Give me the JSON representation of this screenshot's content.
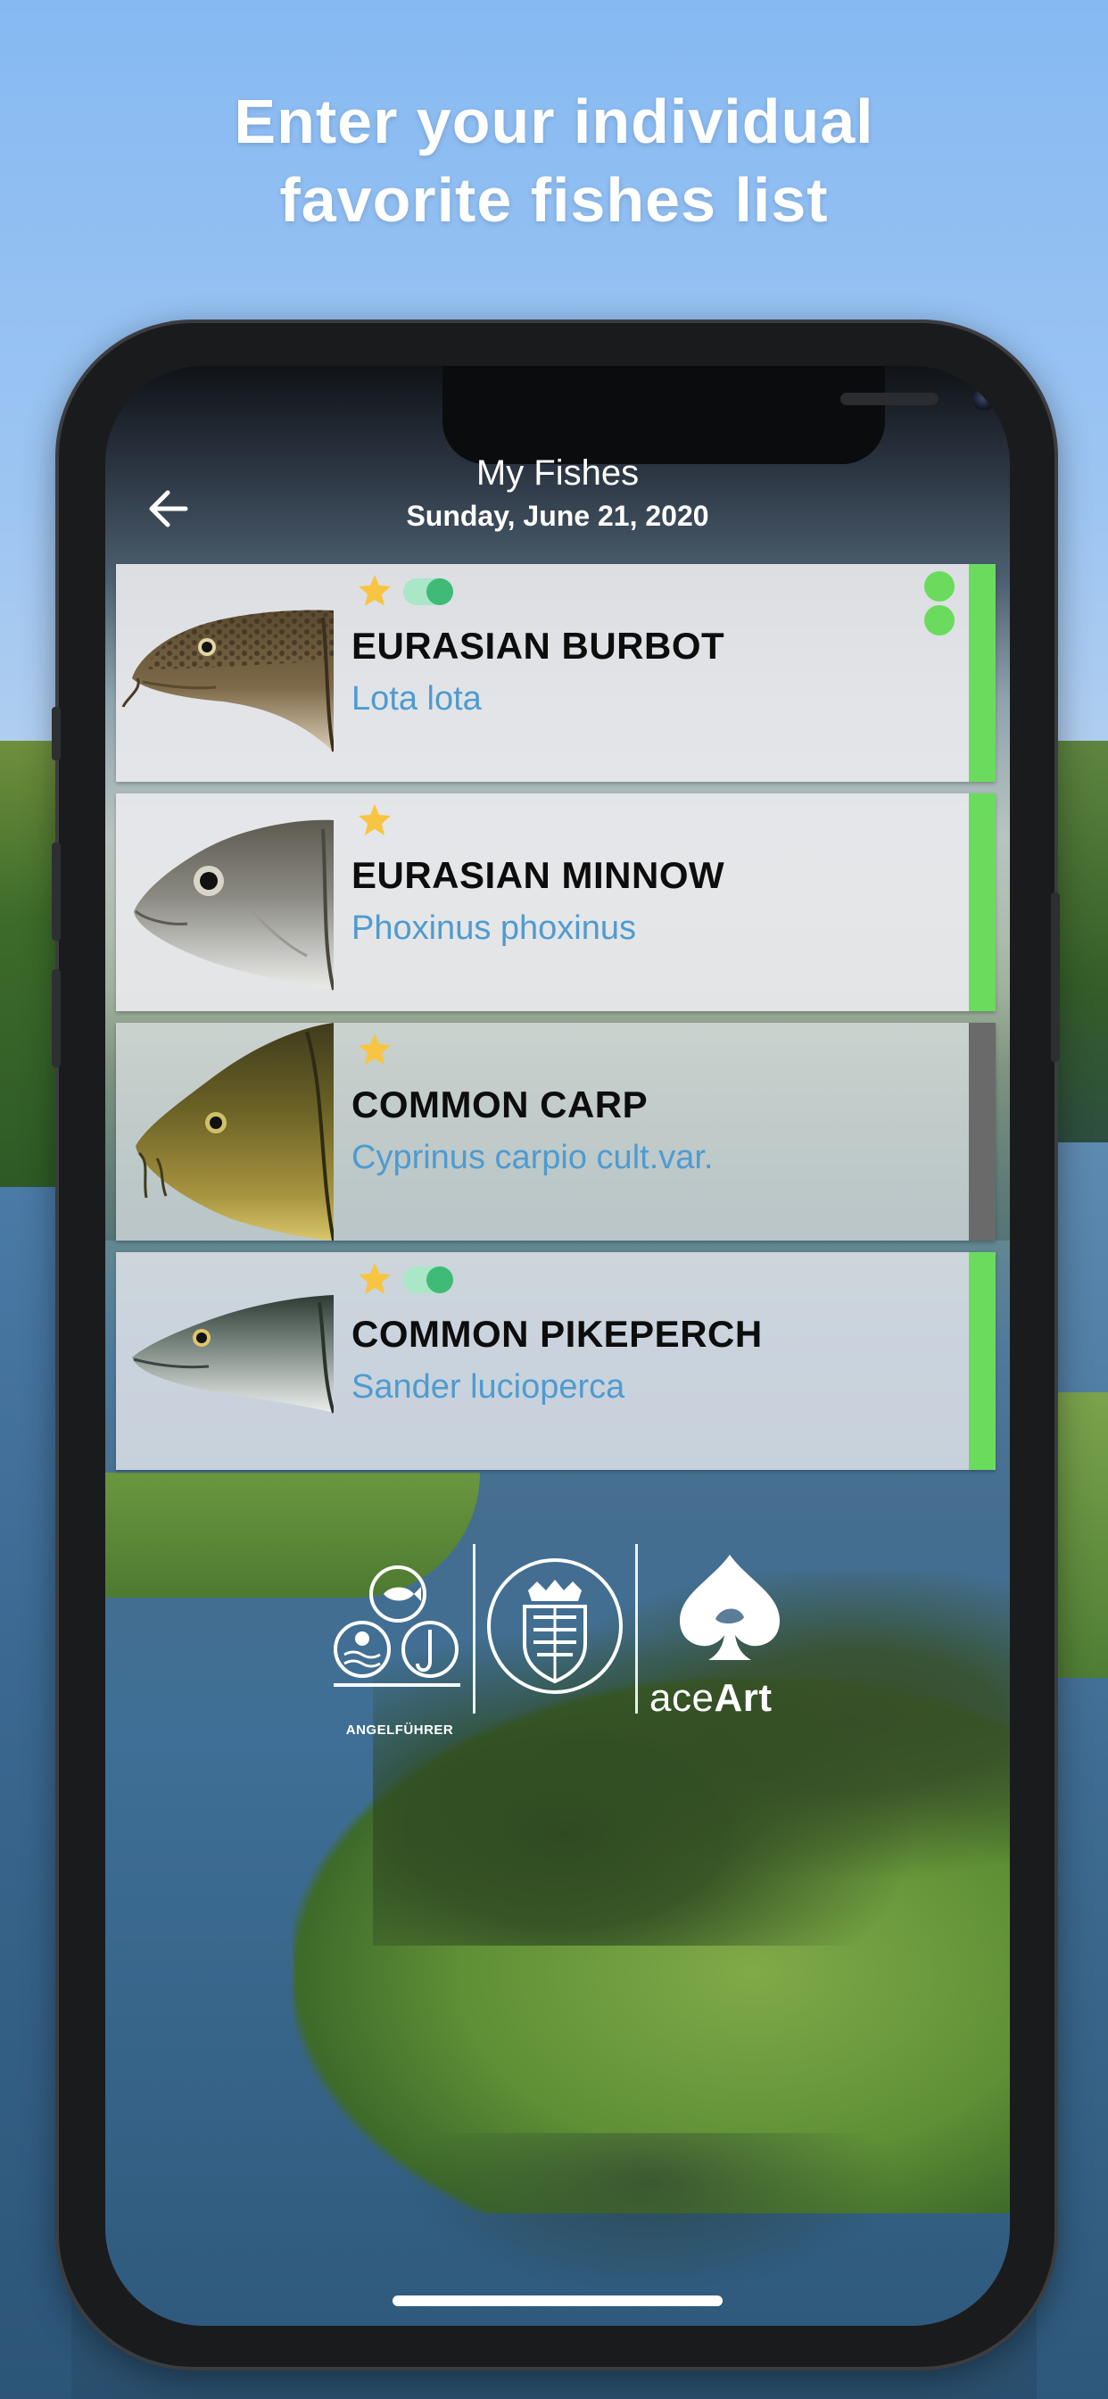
{
  "promo": {
    "headline_line1": "Enter your individual",
    "headline_line2": "favorite fishes list"
  },
  "header": {
    "title": "My Fishes",
    "date": "Sunday, June 21, 2020",
    "back_icon": "arrow-left-icon"
  },
  "fishes": [
    {
      "name": "EURASIAN BURBOT",
      "latin": "Lota lota",
      "favorite": true,
      "toggle_on": true,
      "status_color": "#6bdb5d",
      "indicator_dots": 2
    },
    {
      "name": "EURASIAN MINNOW",
      "latin": "Phoxinus phoxinus",
      "favorite": true,
      "toggle_on": false,
      "status_color": "#6bdb5d",
      "indicator_dots": 0
    },
    {
      "name": "COMMON CARP",
      "latin": "Cyprinus carpio cult.var.",
      "favorite": true,
      "toggle_on": false,
      "status_color": "#6a6a6a",
      "indicator_dots": 0
    },
    {
      "name": "COMMON PIKEPERCH",
      "latin": "Sander lucioperca",
      "favorite": true,
      "toggle_on": true,
      "status_color": "#6bdb5d",
      "indicator_dots": 0
    }
  ],
  "logos": {
    "angelfuehrer_label": "ANGELFÜHRER",
    "ace_prefix": "ace",
    "ace_suffix": "Art"
  },
  "colors": {
    "favorite_star": "#f7c542",
    "latin_text": "#4f9bd0",
    "toggle_on": "#3fbb76",
    "status_green": "#6bdb5d",
    "status_gray": "#6a6a6a"
  }
}
